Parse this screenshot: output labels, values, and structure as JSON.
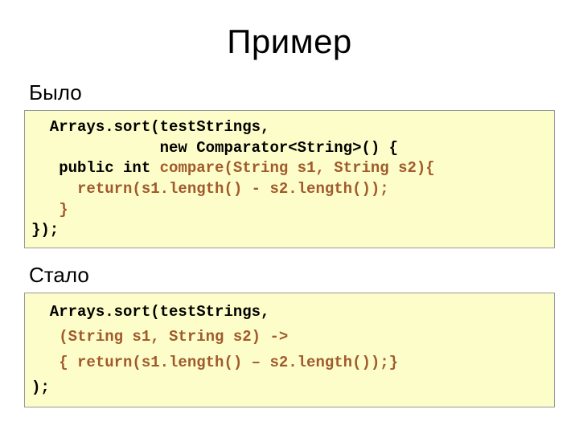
{
  "title": "Пример",
  "before": {
    "label": "Было",
    "code": {
      "l1": "  Arrays.sort(testStrings,",
      "l2": "              new Comparator<String>() {",
      "l3a": "   public int ",
      "l3b": "compare(String s1, String s2){",
      "l4": "     return(s1.length() - s2.length());",
      "l5": "   }",
      "l6": "});"
    }
  },
  "after": {
    "label": "Стало",
    "code": {
      "l1": "  Arrays.sort(testStrings,",
      "l2": "   (String s1, String s2) ->",
      "l3": "   { return(s1.length() – s2.length());}",
      "l4": ");"
    }
  }
}
